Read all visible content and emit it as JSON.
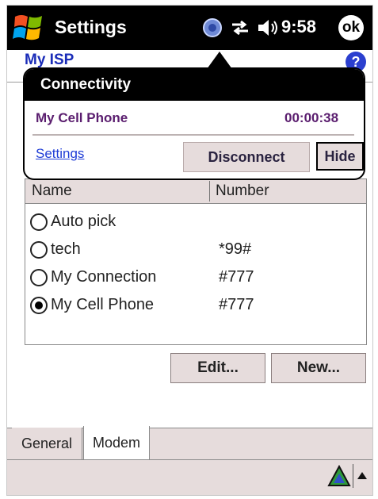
{
  "titlebar": {
    "title": "Settings",
    "time": "9:58",
    "ok_label": "ok",
    "icons": [
      "windows-start-icon",
      "connectivity-icon",
      "sync-arrows-icon",
      "speaker-icon"
    ]
  },
  "page": {
    "title": "My ISP",
    "help_label": "?"
  },
  "connectivity": {
    "title": "Connectivity",
    "connection_name": "My Cell Phone",
    "duration": "00:00:38",
    "settings_link": "Settings",
    "disconnect_label": "Disconnect",
    "hide_label": "Hide"
  },
  "list": {
    "columns": [
      "Name",
      "Number"
    ],
    "rows": [
      {
        "name": "Auto pick",
        "number": "",
        "selected": false
      },
      {
        "name": "tech",
        "number": "*99#",
        "selected": false
      },
      {
        "name": "My Connection",
        "number": "#777",
        "selected": false
      },
      {
        "name": "My Cell Phone",
        "number": "#777",
        "selected": true
      }
    ]
  },
  "buttons": {
    "edit_label": "Edit...",
    "new_label": "New..."
  },
  "tabs": [
    {
      "label": "General",
      "active": false
    },
    {
      "label": "Modem",
      "active": true
    }
  ],
  "colors": {
    "accent": "#1a2cb8",
    "button_face": "#e6dcdc",
    "connection_text": "#5a1d6e"
  }
}
